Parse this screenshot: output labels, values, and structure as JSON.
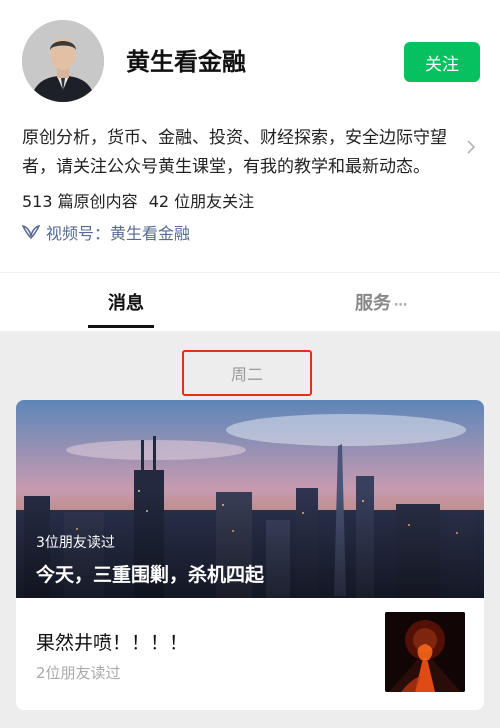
{
  "profile": {
    "name": "黄生看金融",
    "follow_label": "关注",
    "description": "原创分析，货币、金融、投资、财经探索，安全边际守望者，请关注公众号黄生课堂，有我的教学和最新动态。",
    "original_count": "513 篇原创内容",
    "friends_following": "42 位朋友关注",
    "video_channel": "视频号：黄生看金融"
  },
  "tabs": [
    {
      "label": "消息",
      "active": true
    },
    {
      "label": "服务",
      "active": false
    }
  ],
  "feed": {
    "date_label": "周二",
    "articles": [
      {
        "title": "今天，三重围剿，杀机四起",
        "readers": "3位朋友读过"
      },
      {
        "title": "果然井喷！！！！",
        "readers": "2位朋友读过"
      }
    ]
  },
  "colors": {
    "accent": "#07c160",
    "link": "#576b95",
    "highlight_border": "#e0301e"
  },
  "icons": [
    "chevron-right-icon",
    "video-channel-icon",
    "more-dots-icon"
  ]
}
